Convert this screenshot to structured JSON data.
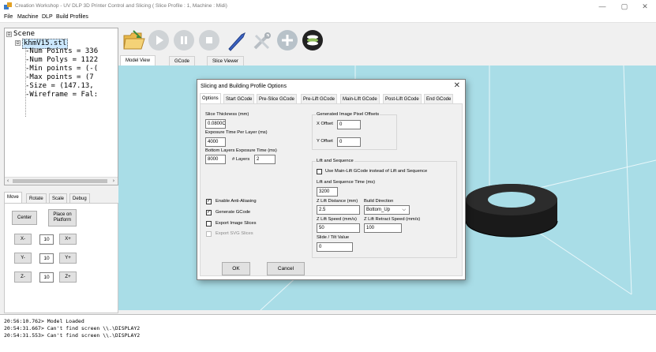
{
  "window": {
    "title": "Creation Workshop - UV DLP 3D Printer Control and Slicing  ( Slice Profile : 1, Machine : Midi)",
    "minimize": "—",
    "maximize": "▢",
    "close": "✕"
  },
  "menu": [
    "File",
    "Machine",
    "DLP",
    "Build Profiles"
  ],
  "tree": {
    "root_expander": "⊟",
    "root": "Scene",
    "model_expander": "⊟",
    "model": "khmV15.stl",
    "props": [
      "Num Points = 336",
      "Num Polys = 1122",
      "Min points = (-(",
      "Max points = (7",
      "Size = (147.13,",
      "Wireframe = Fal:"
    ]
  },
  "left_tabs": [
    "Move",
    "Rotate",
    "Scale",
    "Debug"
  ],
  "move_panel": {
    "center": "Center",
    "place_on_platform": "Place on Platform",
    "rows": [
      {
        "minus": "X-",
        "value": "10",
        "plus": "X+"
      },
      {
        "minus": "Y-",
        "value": "10",
        "plus": "Y+"
      },
      {
        "minus": "Z-",
        "value": "10",
        "plus": "Z+"
      }
    ]
  },
  "toolbar_icons": [
    "open-folder-icon",
    "play-icon",
    "pause-icon",
    "stop-icon",
    "slice-knife-icon",
    "tools-icon",
    "add-icon",
    "layers-icon"
  ],
  "main_tabs": [
    "Model View",
    "GCode",
    "Slice Viewer"
  ],
  "log": [
    "20:56:10.762> Model Loaded",
    "20:54:31.667> Can't find screen \\\\.\\DISPLAY2",
    "20:54:31.553> Can't find screen \\\\.\\DISPLAY2"
  ],
  "dialog": {
    "title": "Slicing and Building Profile Options",
    "close": "✕",
    "tabs": [
      "Options",
      "Start GCode",
      "Pre-Slice GCode",
      "Pre-Lift GCode",
      "Main-Lift GCode",
      "Post-Lift GCode",
      "End GCode"
    ],
    "slice_thickness_label": "Slice Thickness (mm)",
    "slice_thickness": "0.0800C",
    "exposure_label": "Exposure Time Per Layer (ms)",
    "exposure": "4000",
    "bottom_exposure_label": "Bottom Layers Exposure Time (ms)",
    "bottom_exposure": "8000",
    "layers_label": "# Layers",
    "layers": "2",
    "pixel_offsets_title": "Generated Image Pixel Offsets",
    "x_offset_label": "X Offset",
    "x_offset": "0",
    "y_offset_label": "Y Offset",
    "y_offset": "0",
    "lift_group_title": "Lift and Sequence",
    "use_mainlift_label": "Use Main-Lift GCode instead of Lift and Sequence",
    "lift_seq_time_label": "Lift and Sequence Time (ms)",
    "lift_seq_time": "3200",
    "z_lift_dist_label": "Z Lift Distance (mm)",
    "build_dir_label": "Build Direction",
    "z_lift_dist": "2.5",
    "build_dir": "Bottom_Up",
    "z_lift_speed_label": "Z Lift Speed (mm/s)",
    "z_retract_label": "Z Lift Retract Speed (mm/s)",
    "z_lift_speed": "50",
    "z_retract": "100",
    "slide_tilt_label": "Slide / Tilt Value",
    "slide_tilt": "0",
    "anti_alias_label": "Enable Anti-Aliasing",
    "gen_gcode_label": "Generate GCode",
    "export_images_label": "Export Image Slices",
    "export_svg_label": "Export SVG Slices",
    "checkmark": "✓",
    "ok": "OK",
    "cancel": "Cancel"
  },
  "colors": {
    "viewport": "#a9dde7",
    "model": "#1a1a1a",
    "tree_selected": "#cce8ff"
  }
}
